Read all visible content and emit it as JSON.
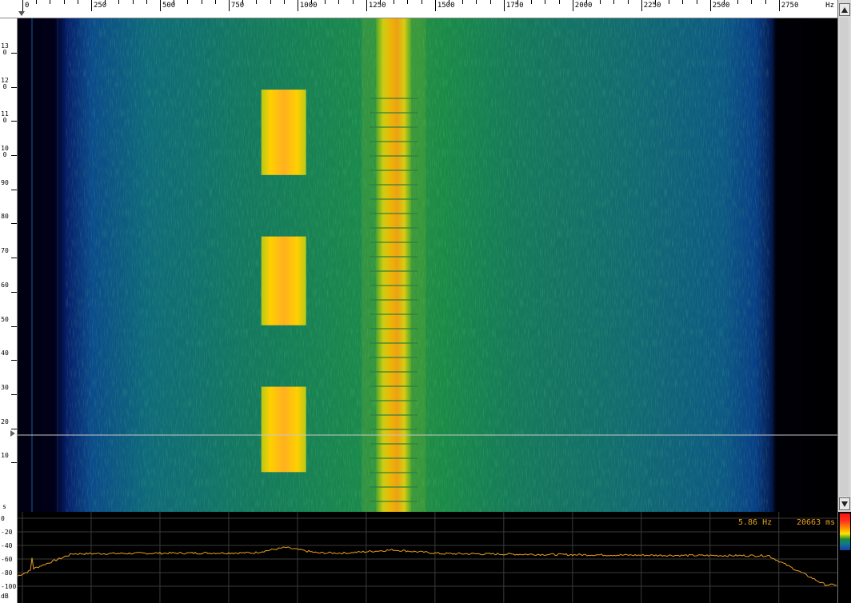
{
  "frequency_axis": {
    "unit": "Hz",
    "ticks": [
      "0",
      "250",
      "500",
      "750",
      "1000",
      "1250",
      "1500",
      "1750",
      "2000",
      "2250",
      "2500",
      "2750"
    ]
  },
  "time_axis": {
    "unit": "s",
    "ticks": [
      "130",
      "120",
      "110",
      "100",
      "90",
      "80",
      "70",
      "60",
      "50",
      "40",
      "30",
      "20",
      "10"
    ]
  },
  "spectrum_axis": {
    "unit": "dB",
    "ticks": [
      "0",
      "-20",
      "-40",
      "-60",
      "-80",
      "-100"
    ]
  },
  "readouts": {
    "resolution": "5.86 Hz",
    "duration": "20663 ms"
  },
  "colors": {
    "background": "#000000",
    "ruler": "#ffffff",
    "trace": "#e8a020",
    "grid": "#3a3a3a"
  },
  "signals": {
    "carrier_hz": 1350,
    "keyed_tone_hz": 950,
    "keyed_tone_on_seconds": [
      [
        97,
        122
      ],
      [
        53,
        79
      ],
      [
        10,
        35
      ]
    ]
  },
  "controls": {
    "scroll_up": "scroll-up",
    "scroll_down": "scroll-down"
  }
}
